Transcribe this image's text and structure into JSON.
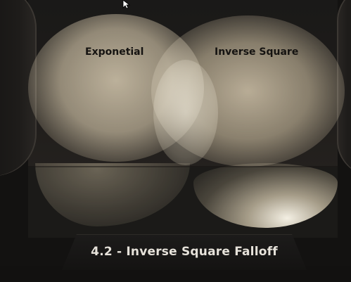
{
  "labels": {
    "left": "Exponetial",
    "right": "Inverse Square"
  },
  "caption": "4.2 - Inverse Square Falloff",
  "colors": {
    "background": "#131211",
    "light": "#d2c4a8",
    "label_text": "#151311",
    "caption_text": "#e6e2da"
  },
  "icons": {
    "cursor": "mouse-pointer-icon"
  }
}
